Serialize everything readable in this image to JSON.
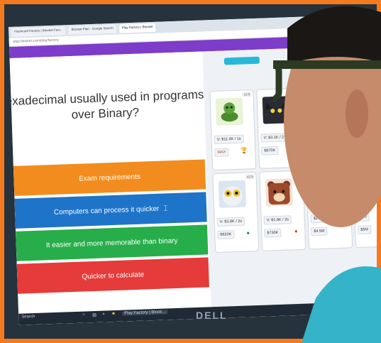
{
  "browser": {
    "tabs": [
      "Flashcard Factory | Blooket Fact...",
      "Blooket Plan - Google Search",
      "Play Factory | Blooket"
    ],
    "address": "play.blooket.com/play/factory"
  },
  "quiz": {
    "question": "exadecimal usually used in programs over Binary?",
    "answers": [
      "Exam requirements",
      "Computers can process it quicker",
      "It easier and more memorable than binary",
      "Quicker to calculate"
    ]
  },
  "blooks": [
    {
      "level": "x2.5",
      "value": "V: $11.4K / 1s",
      "button": "MAX",
      "icon": "snake-blook-icon"
    },
    {
      "level": "",
      "value": "V: $3.1K / 2",
      "button": "$870K",
      "icon": "black-cat-blook-icon"
    },
    {
      "level": "x2.5",
      "value": "V: $3.8K / 2s",
      "button": "$620K",
      "icon": "owl-blook-icon"
    },
    {
      "level": "",
      "value": "V: $1.9K / 2s",
      "button": "$730K",
      "icon": "bear-blook-icon"
    },
    {
      "level": "",
      "value": "$24K / 2s",
      "button": "$4.5M",
      "icon": "blook-icon"
    },
    {
      "level": "",
      "value": "$50",
      "button": "$5M",
      "icon": "blook-icon"
    }
  ],
  "taskbar": {
    "search": "Search",
    "active_app": "Play Factory | Blook..."
  },
  "bezel": {
    "brand": "DELL"
  },
  "colors": {
    "frame": "#f47a20",
    "purple": "#7d3cc9",
    "a1": "#f28c1e",
    "a2": "#1e74c8",
    "a3": "#27ae4a",
    "a4": "#e53b3b"
  }
}
